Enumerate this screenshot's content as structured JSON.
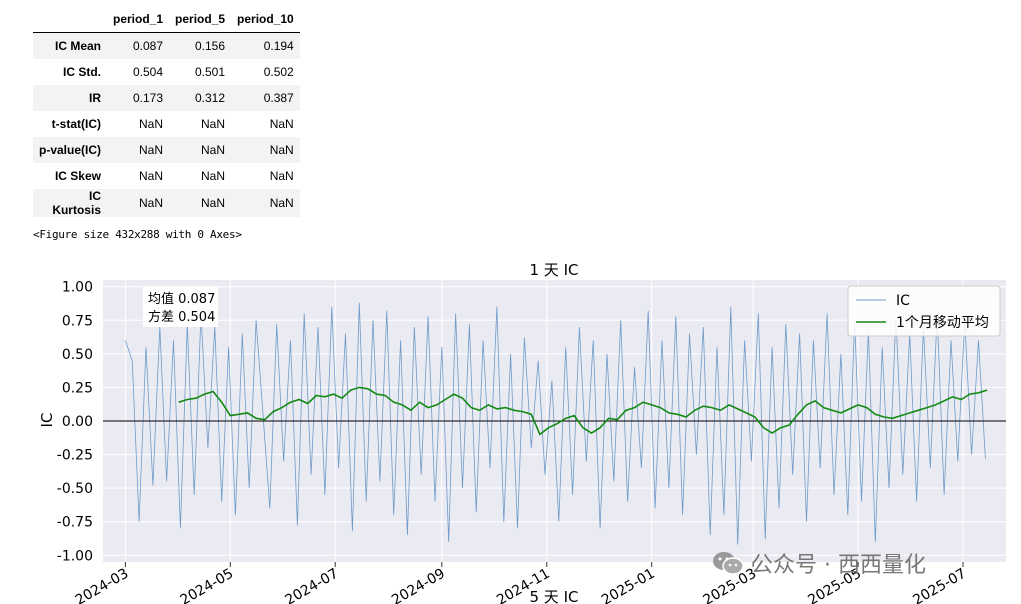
{
  "table": {
    "columns": [
      "period_1",
      "period_5",
      "period_10"
    ],
    "rows": [
      {
        "label": "IC Mean",
        "values": [
          "0.087",
          "0.156",
          "0.194"
        ]
      },
      {
        "label": "IC Std.",
        "values": [
          "0.504",
          "0.501",
          "0.502"
        ]
      },
      {
        "label": "IR",
        "values": [
          "0.173",
          "0.312",
          "0.387"
        ]
      },
      {
        "label": "t-stat(IC)",
        "values": [
          "NaN",
          "NaN",
          "NaN"
        ]
      },
      {
        "label": "p-value(IC)",
        "values": [
          "NaN",
          "NaN",
          "NaN"
        ]
      },
      {
        "label": "IC Skew",
        "values": [
          "NaN",
          "NaN",
          "NaN"
        ]
      },
      {
        "label": "IC Kurtosis",
        "values": [
          "NaN",
          "NaN",
          "NaN"
        ]
      }
    ]
  },
  "figure_size_text": "<Figure size 432x288 with 0 Axes>",
  "watermark_text": "公众号 · 西西量化",
  "chart_data": {
    "type": "line",
    "title": "1 天 IC",
    "xlabel": "5 天 IC",
    "ylabel": "IC",
    "ylim": [
      -1.05,
      1.05
    ],
    "yticks": [
      "1.00",
      "0.75",
      "0.50",
      "0.25",
      "0.00",
      "-0.25",
      "-0.50",
      "-0.75",
      "-1.00"
    ],
    "xticks": [
      "2024-03",
      "2024-05",
      "2024-07",
      "2024-09",
      "2024-11",
      "2025-01",
      "2025-03",
      "2025-05",
      "2025-07"
    ],
    "annotation": [
      "均值 0.087",
      "方差 0.504"
    ],
    "legend_position": "top-right",
    "colors": {
      "ic": "#6f9bc7",
      "ma": "#138a13",
      "zero": "#000000",
      "background": "#eaeaf2",
      "grid": "#ffffff"
    },
    "series": [
      {
        "name": "IC",
        "x": [
          "2024-03-01",
          "2024-03-05",
          "2024-03-09",
          "2024-03-13",
          "2024-03-17",
          "2024-03-21",
          "2024-03-25",
          "2024-03-29",
          "2024-04-02",
          "2024-04-06",
          "2024-04-10",
          "2024-04-14",
          "2024-04-18",
          "2024-04-22",
          "2024-04-26",
          "2024-04-30",
          "2024-05-04",
          "2024-05-08",
          "2024-05-12",
          "2024-05-16",
          "2024-05-20",
          "2024-05-24",
          "2024-05-28",
          "2024-06-01",
          "2024-06-05",
          "2024-06-09",
          "2024-06-13",
          "2024-06-17",
          "2024-06-21",
          "2024-06-25",
          "2024-06-29",
          "2024-07-03",
          "2024-07-07",
          "2024-07-11",
          "2024-07-15",
          "2024-07-19",
          "2024-07-23",
          "2024-07-27",
          "2024-07-31",
          "2024-08-04",
          "2024-08-08",
          "2024-08-12",
          "2024-08-16",
          "2024-08-20",
          "2024-08-24",
          "2024-08-28",
          "2024-09-01",
          "2024-09-05",
          "2024-09-09",
          "2024-09-13",
          "2024-09-17",
          "2024-09-21",
          "2024-09-25",
          "2024-09-29",
          "2024-10-03",
          "2024-10-07",
          "2024-10-11",
          "2024-10-15",
          "2024-10-19",
          "2024-10-23",
          "2024-10-27",
          "2024-10-31",
          "2024-11-04",
          "2024-11-08",
          "2024-11-12",
          "2024-11-16",
          "2024-11-20",
          "2024-11-24",
          "2024-11-28",
          "2024-12-02",
          "2024-12-06",
          "2024-12-10",
          "2024-12-14",
          "2024-12-18",
          "2024-12-22",
          "2024-12-26",
          "2024-12-30",
          "2025-01-03",
          "2025-01-07",
          "2025-01-11",
          "2025-01-15",
          "2025-01-19",
          "2025-01-23",
          "2025-01-27",
          "2025-01-31",
          "2025-02-04",
          "2025-02-08",
          "2025-02-12",
          "2025-02-16",
          "2025-02-20",
          "2025-02-24",
          "2025-02-28",
          "2025-03-04",
          "2025-03-08",
          "2025-03-12",
          "2025-03-16",
          "2025-03-20",
          "2025-03-24",
          "2025-03-28",
          "2025-04-01",
          "2025-04-05",
          "2025-04-09",
          "2025-04-13",
          "2025-04-17",
          "2025-04-21",
          "2025-04-25",
          "2025-04-29",
          "2025-05-03",
          "2025-05-07",
          "2025-05-11",
          "2025-05-15",
          "2025-05-19",
          "2025-05-23",
          "2025-05-27",
          "2025-05-31",
          "2025-06-04",
          "2025-06-08",
          "2025-06-12",
          "2025-06-16",
          "2025-06-20",
          "2025-06-24",
          "2025-06-28",
          "2025-07-02",
          "2025-07-06",
          "2025-07-10",
          "2025-07-14"
        ],
        "values": [
          0.6,
          0.45,
          -0.75,
          0.55,
          -0.48,
          0.7,
          -0.45,
          0.6,
          -0.8,
          0.72,
          -0.55,
          0.8,
          -0.2,
          0.7,
          -0.6,
          0.55,
          -0.7,
          0.65,
          -0.5,
          0.75,
          0.05,
          -0.65,
          0.72,
          -0.3,
          0.6,
          -0.78,
          0.8,
          -0.4,
          0.7,
          -0.55,
          0.85,
          -0.35,
          0.65,
          -0.82,
          0.88,
          -0.6,
          0.75,
          -0.45,
          0.82,
          -0.7,
          0.6,
          -0.85,
          0.7,
          -0.4,
          0.78,
          -0.6,
          0.55,
          -0.9,
          0.8,
          -0.5,
          0.72,
          -0.68,
          0.6,
          -0.35,
          0.85,
          -0.75,
          0.5,
          -0.8,
          0.62,
          -0.2,
          0.45,
          -0.4,
          0.3,
          -0.75,
          0.55,
          -0.55,
          0.7,
          -0.3,
          0.6,
          -0.8,
          0.5,
          -0.45,
          0.75,
          -0.6,
          0.4,
          -0.35,
          0.82,
          -0.65,
          0.6,
          -0.5,
          0.78,
          -0.7,
          0.65,
          -0.25,
          0.7,
          -0.85,
          0.55,
          -0.7,
          0.85,
          -0.92,
          0.6,
          -0.3,
          0.8,
          -0.88,
          0.55,
          -0.65,
          0.72,
          -0.4,
          0.65,
          -0.75,
          0.6,
          -0.35,
          0.8,
          -0.55,
          0.5,
          -0.7,
          0.75,
          -0.6,
          0.68,
          -0.9,
          0.55,
          -0.5,
          0.78,
          -0.4,
          0.65,
          -0.6,
          0.7,
          -0.35,
          0.8,
          -0.55,
          0.6,
          -0.3,
          0.75,
          -0.25,
          0.6,
          -0.28
        ]
      },
      {
        "name": "1个月移动平均",
        "x": [
          "2024-04-01",
          "2024-04-06",
          "2024-04-11",
          "2024-04-16",
          "2024-04-21",
          "2024-04-26",
          "2024-05-01",
          "2024-05-06",
          "2024-05-11",
          "2024-05-16",
          "2024-05-21",
          "2024-05-26",
          "2024-05-31",
          "2024-06-05",
          "2024-06-10",
          "2024-06-15",
          "2024-06-20",
          "2024-06-25",
          "2024-06-30",
          "2024-07-05",
          "2024-07-10",
          "2024-07-15",
          "2024-07-20",
          "2024-07-25",
          "2024-07-30",
          "2024-08-04",
          "2024-08-09",
          "2024-08-14",
          "2024-08-19",
          "2024-08-24",
          "2024-08-29",
          "2024-09-03",
          "2024-09-08",
          "2024-09-13",
          "2024-09-18",
          "2024-09-23",
          "2024-09-28",
          "2024-10-03",
          "2024-10-08",
          "2024-10-13",
          "2024-10-18",
          "2024-10-23",
          "2024-10-28",
          "2024-11-02",
          "2024-11-07",
          "2024-11-12",
          "2024-11-17",
          "2024-11-22",
          "2024-11-27",
          "2024-12-02",
          "2024-12-07",
          "2024-12-12",
          "2024-12-17",
          "2024-12-22",
          "2024-12-27",
          "2025-01-01",
          "2025-01-06",
          "2025-01-11",
          "2025-01-16",
          "2025-01-21",
          "2025-01-26",
          "2025-01-31",
          "2025-02-05",
          "2025-02-10",
          "2025-02-15",
          "2025-02-20",
          "2025-02-25",
          "2025-03-02",
          "2025-03-07",
          "2025-03-12",
          "2025-03-17",
          "2025-03-22",
          "2025-03-27",
          "2025-04-01",
          "2025-04-06",
          "2025-04-11",
          "2025-04-16",
          "2025-04-21",
          "2025-04-26",
          "2025-05-01",
          "2025-05-06",
          "2025-05-11",
          "2025-05-16",
          "2025-05-21",
          "2025-05-26",
          "2025-05-31",
          "2025-06-05",
          "2025-06-10",
          "2025-06-15",
          "2025-06-20",
          "2025-06-25",
          "2025-06-30",
          "2025-07-05",
          "2025-07-10",
          "2025-07-15"
        ],
        "values": [
          0.14,
          0.16,
          0.17,
          0.2,
          0.22,
          0.14,
          0.04,
          0.05,
          0.06,
          0.02,
          0.01,
          0.07,
          0.1,
          0.14,
          0.16,
          0.13,
          0.19,
          0.18,
          0.2,
          0.17,
          0.23,
          0.25,
          0.24,
          0.2,
          0.19,
          0.14,
          0.12,
          0.08,
          0.14,
          0.1,
          0.12,
          0.16,
          0.2,
          0.17,
          0.1,
          0.08,
          0.12,
          0.09,
          0.1,
          0.08,
          0.07,
          0.05,
          -0.1,
          -0.05,
          -0.02,
          0.02,
          0.04,
          -0.05,
          -0.09,
          -0.05,
          0.02,
          0.01,
          0.08,
          0.1,
          0.14,
          0.12,
          0.1,
          0.06,
          0.05,
          0.03,
          0.08,
          0.11,
          0.1,
          0.08,
          0.12,
          0.09,
          0.06,
          0.03,
          -0.05,
          -0.09,
          -0.05,
          -0.03,
          0.05,
          0.12,
          0.15,
          0.1,
          0.08,
          0.06,
          0.09,
          0.12,
          0.1,
          0.05,
          0.03,
          0.02,
          0.04,
          0.06,
          0.08,
          0.1,
          0.12,
          0.15,
          0.18,
          0.16,
          0.2,
          0.21,
          0.23
        ]
      }
    ]
  }
}
